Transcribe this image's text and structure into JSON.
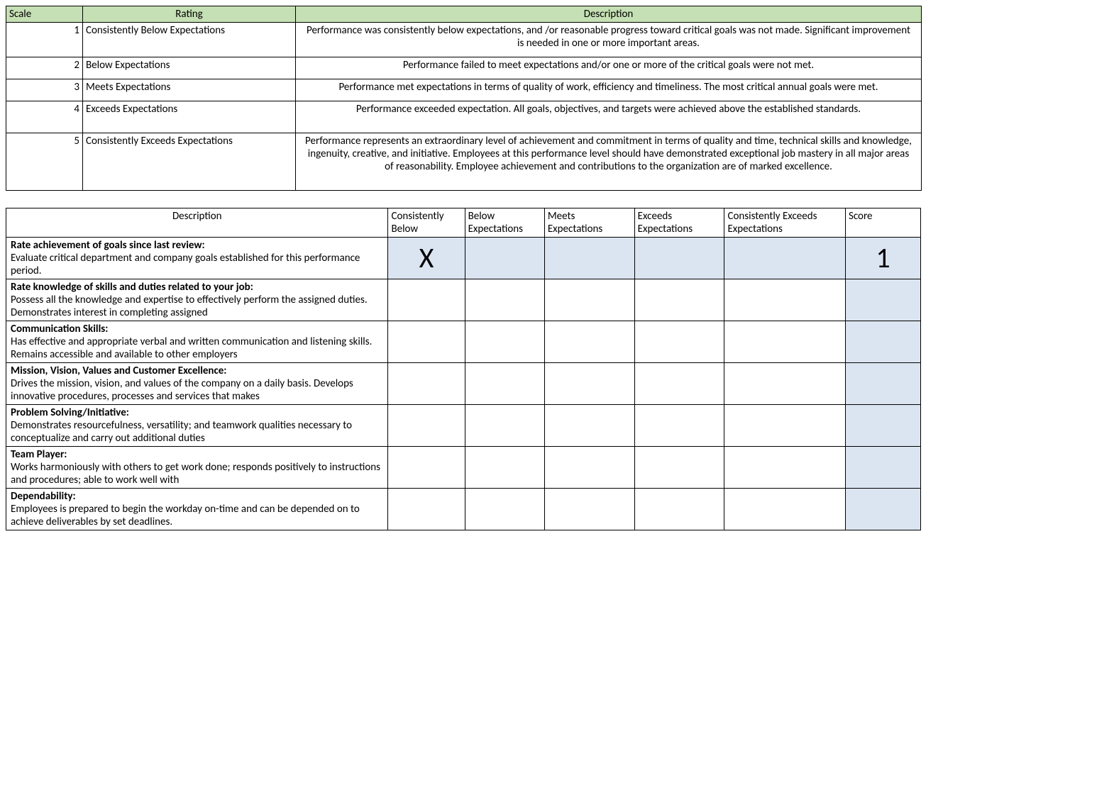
{
  "scaleTable": {
    "headers": {
      "scale": "Scale",
      "rating": "Rating",
      "description": "Description"
    },
    "rows": [
      {
        "scale": "1",
        "rating": "Consistently Below Expectations",
        "desc": "Performance was consistently below expectations, and /or reasonable progress toward critical goals was not made. Significant improvement is needed in one or more important areas."
      },
      {
        "scale": "2",
        "rating": " Below Expectations",
        "desc": "Performance failed to meet expectations and/or one or more of the critical goals were not met."
      },
      {
        "scale": "3",
        "rating": "Meets Expectations",
        "desc": "Performance met expectations in terms of quality of work, efficiency and timeliness. The most critical annual goals were met."
      },
      {
        "scale": "4",
        "rating": "Exceeds Expectations",
        "desc": "Performance exceeded expectation. All goals, objectives, and targets were achieved above the established standards."
      },
      {
        "scale": "5",
        "rating": "Consistently Exceeds Expectations",
        "desc": "Performance represents an extraordinary level of achievement and commitment in terms of quality and time, technical skills and knowledge, ingenuity, creative, and initiative. Employees at this performance level should have demonstrated exceptional job mastery in all major areas of reasonability. Employee achievement and contributions to the organization are of marked excellence."
      }
    ]
  },
  "evalTable": {
    "headers": {
      "desc": "Description",
      "c1": "Consistently Below",
      "c2": "Below Expectations",
      "c3": "Meets Expectations",
      "c4": "Exceeds Expectations",
      "c5": "Consistently Exceeds Expectations",
      "score": "Score"
    },
    "rows": [
      {
        "title": "Rate achievement of goals since last review:",
        "body": "Evaluate critical department and company goals established for this performance period.",
        "marks": [
          "X",
          "",
          "",
          "",
          ""
        ],
        "score": "1"
      },
      {
        "title": "Rate knowledge of skills and duties related to your job:",
        "body": "Possess all the knowledge and expertise to effectively perform the assigned duties. Demonstrates interest in completing assigned",
        "marks": [
          "",
          "",
          "",
          "",
          ""
        ],
        "score": ""
      },
      {
        "title": "Communication Skills:",
        "body": "Has effective and appropriate verbal and written communication and listening skills. Remains accessible and available to other employers",
        "marks": [
          "",
          "",
          "",
          "",
          ""
        ],
        "score": ""
      },
      {
        "title": "Mission, Vision, Values and Customer Excellence:",
        "body": "Drives the mission, vision, and values of the company on a daily basis. Develops innovative procedures, processes and services that makes",
        "marks": [
          "",
          "",
          "",
          "",
          ""
        ],
        "score": ""
      },
      {
        "title": "Problem Solving/Initiative:",
        "body": "Demonstrates resourcefulness, versatility; and teamwork qualities necessary to conceptualize and carry out additional duties",
        "marks": [
          "",
          "",
          "",
          "",
          ""
        ],
        "score": ""
      },
      {
        "title": "Team Player:",
        "body": "Works harmoniously with others to get work done; responds positively to instructions and procedures; able to work well with",
        "marks": [
          "",
          "",
          "",
          "",
          ""
        ],
        "score": ""
      },
      {
        "title": "Dependability:",
        "body": "Employees is prepared to begin the workday on-time and can be depended on to achieve deliverables by set deadlines.",
        "marks": [
          "",
          "",
          "",
          "",
          ""
        ],
        "score": ""
      }
    ]
  }
}
